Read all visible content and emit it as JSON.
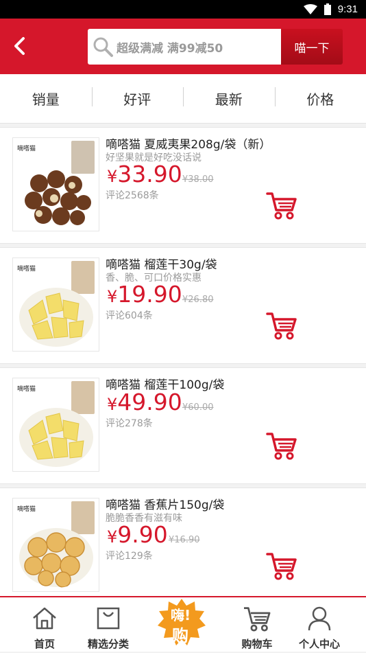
{
  "status": {
    "time": "9:31"
  },
  "header": {
    "search_placeholder": "超级满减 满99减50",
    "search_button": "喵一下"
  },
  "sort_tabs": [
    "销量",
    "好评",
    "最新",
    "价格"
  ],
  "products": [
    {
      "title": "嘀嗒猫 夏威夷果208g/袋（新）",
      "subtitle": "好坚果就是好吃没话说",
      "yen": "¥",
      "price": "33.90",
      "old_price": "¥38.00",
      "reviews": "评论2568条",
      "brand": "嘀嗒猫"
    },
    {
      "title": "嘀嗒猫 榴莲干30g/袋",
      "subtitle": "香、脆、可口价格实惠",
      "yen": "¥",
      "price": "19.90",
      "old_price": "¥26.80",
      "reviews": "评论604条",
      "brand": "嘀嗒猫"
    },
    {
      "title": "嘀嗒猫 榴莲干100g/袋",
      "subtitle": "",
      "yen": "¥",
      "price": "49.90",
      "old_price": "¥60.00",
      "reviews": "评论278条",
      "brand": "嘀嗒猫"
    },
    {
      "title": "嘀嗒猫 香蕉片150g/袋",
      "subtitle": "脆脆香香有滋有味",
      "yen": "¥",
      "price": "9.90",
      "old_price": "¥16.90",
      "reviews": "评论129条",
      "brand": "嘀嗒猫"
    }
  ],
  "tabbar": {
    "home": "首页",
    "category": "精选分类",
    "center_line1": "嗨!",
    "center_line2": "购",
    "cart": "购物车",
    "profile": "个人中心"
  },
  "colors": {
    "brand_red": "#d5172b",
    "status_bar": "#000000"
  }
}
